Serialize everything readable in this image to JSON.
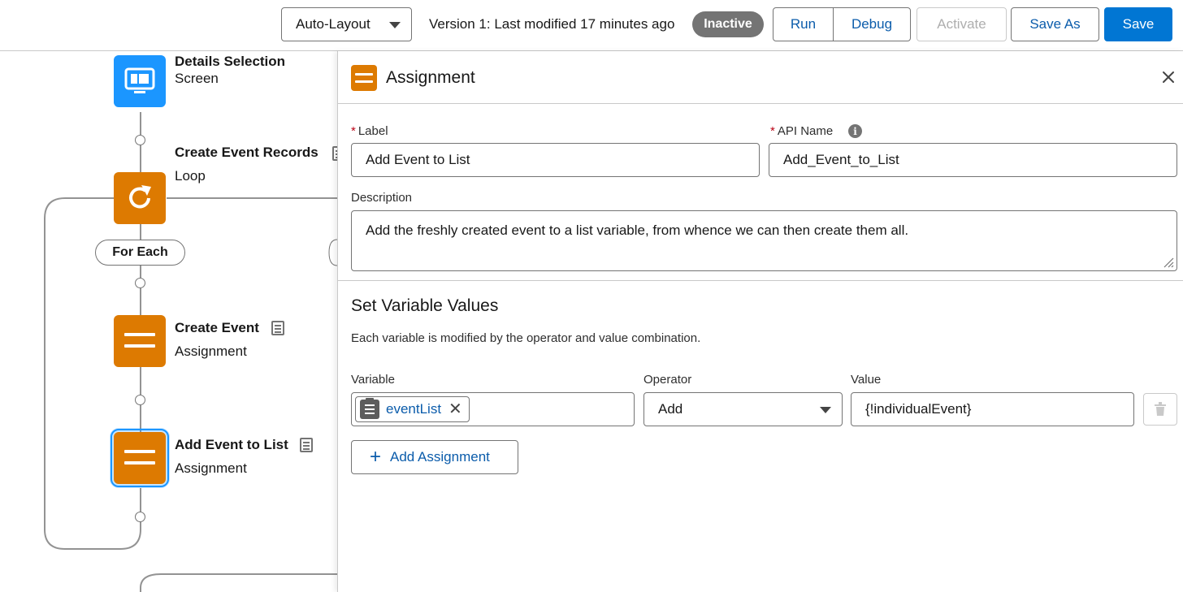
{
  "toolbar": {
    "layout_select": "Auto-Layout",
    "version_text": "Version 1: Last modified 17 minutes ago",
    "status_badge": "Inactive",
    "run": "Run",
    "debug": "Debug",
    "activate": "Activate",
    "save_as": "Save As",
    "save": "Save"
  },
  "canvas": {
    "nodes": [
      {
        "title": "Details Selection",
        "type": "Screen",
        "icon": "screen-icon"
      },
      {
        "title": "Create Event Records",
        "type": "Loop",
        "icon": "loop-icon"
      },
      {
        "title": "Create Event",
        "type": "Assignment",
        "icon": "assignment-icon"
      },
      {
        "title": "Add Event to List",
        "type": "Assignment",
        "icon": "assignment-icon",
        "selected": true
      }
    ],
    "for_each": "For Each"
  },
  "panel": {
    "title": "Assignment",
    "label_field": {
      "label": "Label",
      "required": "*",
      "value": "Add Event to List"
    },
    "api_name_field": {
      "label": "API Name",
      "required": "*",
      "value": "Add_Event_to_List"
    },
    "description_field": {
      "label": "Description",
      "value": "Add the freshly created event to a list variable, from whence we can then create them all."
    },
    "section_title": "Set Variable Values",
    "section_desc": "Each variable is modified by the operator and value combination.",
    "columns": {
      "variable": "Variable",
      "operator": "Operator",
      "value": "Value"
    },
    "assignment_row": {
      "variable": "eventList",
      "operator": "Add",
      "value": "{!individualEvent}"
    },
    "add_assignment": "Add Assignment"
  },
  "colors": {
    "brand_blue": "#0176d3",
    "link_blue": "#0b5cab",
    "screen_node": "#1b96ff",
    "assignment_node": "#dd7a01",
    "badge_gray": "#747474"
  }
}
